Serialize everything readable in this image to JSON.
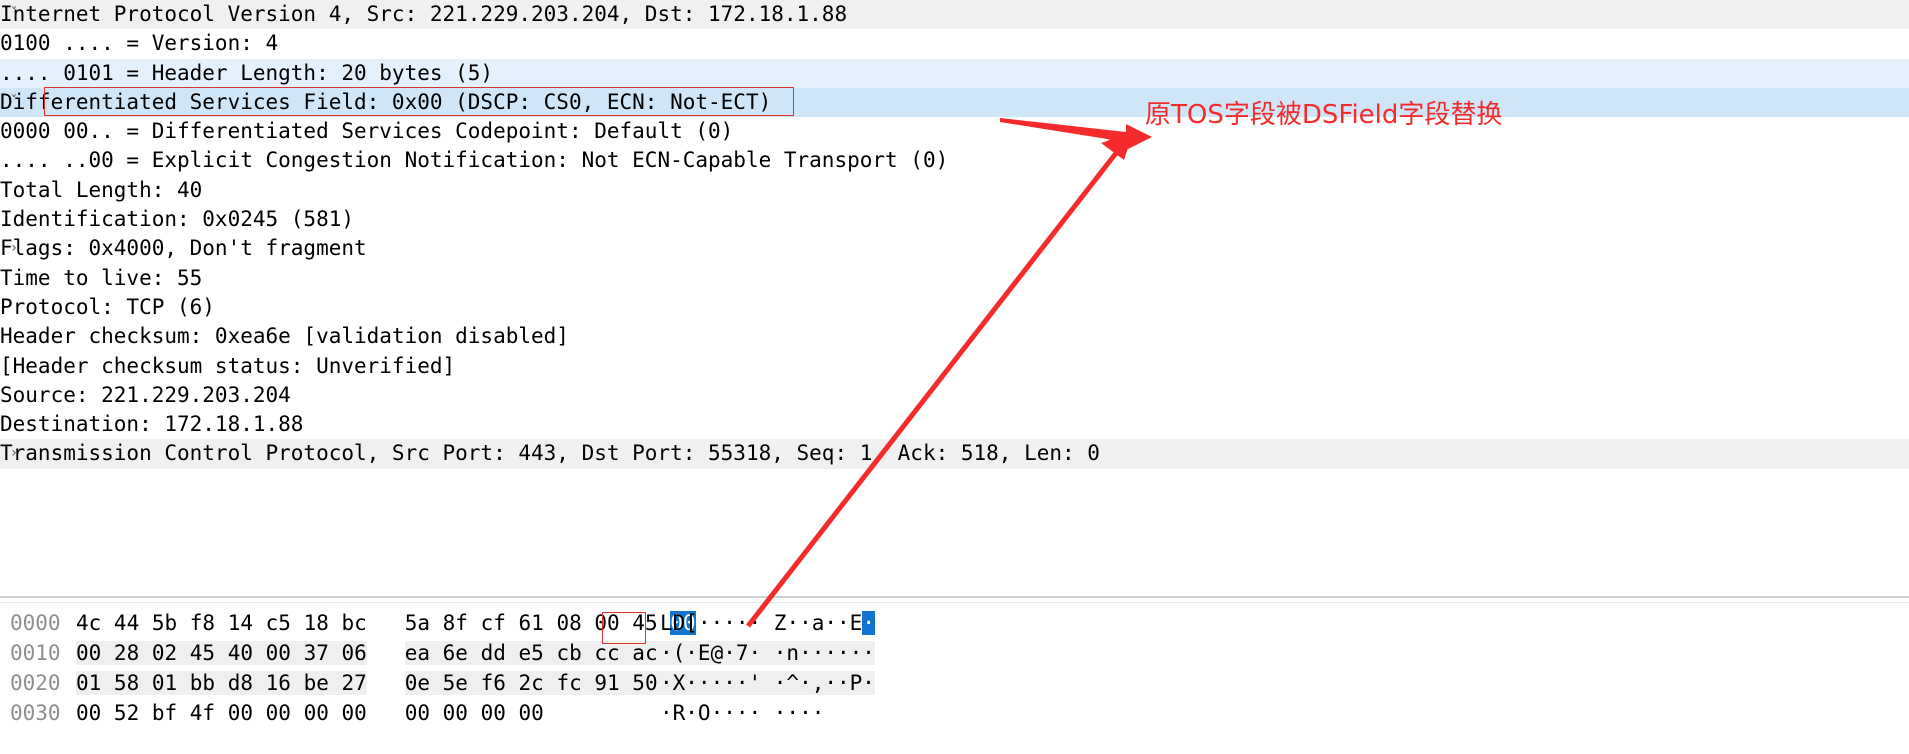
{
  "detail_tree": {
    "rows": [
      {
        "indent": 0,
        "twisty": "expanded",
        "bg": "grey",
        "text": "Internet Protocol Version 4, Src: 221.229.203.204, Dst: 172.18.1.88"
      },
      {
        "indent": 1,
        "twisty": "none",
        "bg": "none",
        "text": "0100 .... = Version: 4"
      },
      {
        "indent": 1,
        "twisty": "none",
        "bg": "light",
        "text": ".... 0101 = Header Length: 20 bytes (5)"
      },
      {
        "indent": 0,
        "twisty": "expanded",
        "bg": "mid",
        "text": "Differentiated Services Field: 0x00 (DSCP: CS0, ECN: Not-ECT)"
      },
      {
        "indent": 2,
        "twisty": "none",
        "bg": "none",
        "text": "0000 00.. = Differentiated Services Codepoint: Default (0)"
      },
      {
        "indent": 2,
        "twisty": "none",
        "bg": "none",
        "text": ".... ..00 = Explicit Congestion Notification: Not ECN-Capable Transport (0)"
      },
      {
        "indent": 1,
        "twisty": "none",
        "bg": "none",
        "text": "Total Length: 40"
      },
      {
        "indent": 1,
        "twisty": "none",
        "bg": "none",
        "text": "Identification: 0x0245 (581)"
      },
      {
        "indent": 1,
        "twisty": "collapsed",
        "bg": "none",
        "text": "Flags: 0x4000, Don't fragment"
      },
      {
        "indent": 1,
        "twisty": "none",
        "bg": "none",
        "text": "Time to live: 55"
      },
      {
        "indent": 1,
        "twisty": "none",
        "bg": "none",
        "text": "Protocol: TCP (6)"
      },
      {
        "indent": 1,
        "twisty": "none",
        "bg": "none",
        "text": "Header checksum: 0xea6e [validation disabled]"
      },
      {
        "indent": 1,
        "twisty": "none",
        "bg": "none",
        "text": "[Header checksum status: Unverified]"
      },
      {
        "indent": 1,
        "twisty": "none",
        "bg": "none",
        "text": "Source: 221.229.203.204"
      },
      {
        "indent": 1,
        "twisty": "none",
        "bg": "none",
        "text": "Destination: 172.18.1.88"
      },
      {
        "indent": 0,
        "twisty": "collapsed",
        "bg": "grey",
        "text": "Transmission Control Protocol, Src Port: 443, Dst Port: 55318, Seq: 1, Ack: 518, Len: 0"
      }
    ],
    "twisty_glyphs": {
      "expanded": "ˇ",
      "collapsed": "›"
    }
  },
  "annotation": {
    "note_text": "原TOS字段被DSField字段替换",
    "color": "#f52b2b"
  },
  "hex_pane": {
    "rows": [
      {
        "offset": "0000",
        "bytes_left": "4c 44 5b f8 14 c5 18 bc",
        "bytes_right_pre": "5a 8f cf 61 08 00 45 ",
        "bytes_right_sel": "00",
        "ascii_pre": "LD[",
        "ascii_mid": "····· Z··a··E",
        "ascii_sel": "·"
      },
      {
        "offset": "0010",
        "bytes_left": "00 28 02 45 40 00 37 06",
        "bytes_right": "ea 6e dd e5 cb cc ac 12",
        "ascii": "·(·E@·7· ·n······"
      },
      {
        "offset": "0020",
        "bytes_left": "01 58 01 bb d8 16 be 27",
        "bytes_right": "0e 5e f6 2c fc 91 50 10",
        "ascii": "·X·····' ·^·,··P·"
      },
      {
        "offset": "0030",
        "bytes_left": "00 52 bf 4f 00 00 00 00",
        "bytes_right": "00 00 00 00",
        "ascii": "·R·O···· ····"
      }
    ],
    "selected_byte": "00",
    "selection_color": "#1076d0"
  },
  "colors": {
    "row_selected_strong": "#cfe5f8",
    "row_selected_light": "#e4f0fb",
    "row_header_grey": "#f0f0f0",
    "annotation_red": "#f52b2b",
    "hex_selection_blue": "#1076d0"
  }
}
